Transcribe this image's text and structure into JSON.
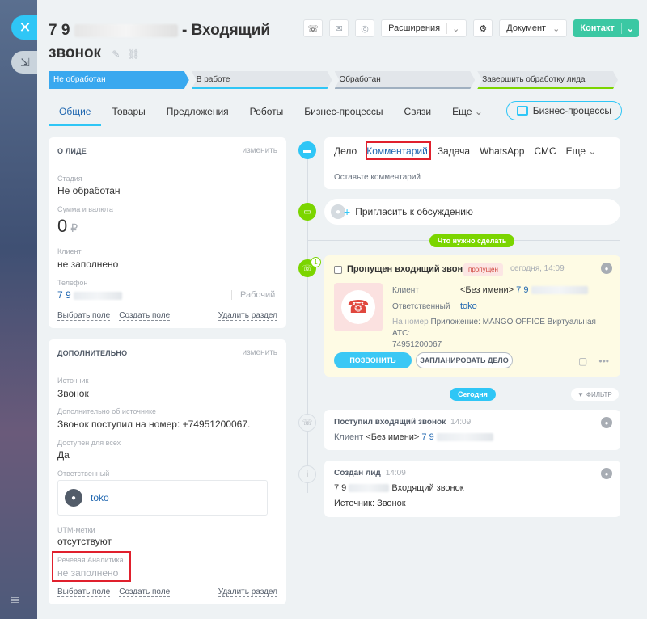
{
  "header": {
    "title_prefix": "7 9",
    "title_suffix": "- Входящий",
    "title_line2": "звонок",
    "extensions_label": "Расширения",
    "document_label": "Документ",
    "contact_label": "Контакт"
  },
  "stages": [
    {
      "label": "Не обработан"
    },
    {
      "label": "В работе"
    },
    {
      "label": "Обработан"
    },
    {
      "label": "Завершить обработку лида"
    }
  ],
  "tabs": [
    {
      "label": "Общие"
    },
    {
      "label": "Товары"
    },
    {
      "label": "Предложения"
    },
    {
      "label": "Роботы"
    },
    {
      "label": "Бизнес-процессы"
    },
    {
      "label": "Связи"
    },
    {
      "label": "Еще"
    }
  ],
  "bp_button": "Бизнес-процессы",
  "about": {
    "heading": "О ЛИДЕ",
    "edit": "изменить",
    "stage_label": "Стадия",
    "stage_value": "Не обработан",
    "sum_label": "Сумма и валюта",
    "sum_value": "0",
    "currency": "₽",
    "client_label": "Клиент",
    "client_value": "не заполнено",
    "phone_label": "Телефон",
    "phone_value": "7 9",
    "phone_type": "Рабочий",
    "select_field": "Выбрать поле",
    "create_field": "Создать поле",
    "delete_section": "Удалить раздел"
  },
  "extra": {
    "heading": "ДОПОЛНИТЕЛЬНО",
    "edit": "изменить",
    "source_label": "Источник",
    "source_value": "Звонок",
    "source_more_label": "Дополнительно об источнике",
    "source_more_value": "Звонок поступил на номер: +74951200067.",
    "avail_label": "Доступен для всех",
    "avail_value": "Да",
    "resp_label": "Ответственный",
    "resp_value": "toko",
    "utm_label": "UTM-метки",
    "utm_value": "отсутствуют",
    "speech_label": "Речевая Аналитика",
    "speech_value": "не заполнено",
    "select_field": "Выбрать поле",
    "create_field": "Создать поле",
    "delete_section": "Удалить раздел"
  },
  "composer": {
    "tabs": [
      "Дело",
      "Комментарий",
      "Задача",
      "WhatsApp",
      "СМС",
      "Еще"
    ],
    "placeholder": "Оставьте комментарий"
  },
  "invite": "Пригласить к обсуждению",
  "todo_pill": "Что нужно сделать",
  "todo": {
    "title": "Пропущен входящий звонок",
    "badge": "пропущен",
    "time": "сегодня, 14:09",
    "client_label": "Клиент",
    "client_value": "<Без имени>",
    "client_phone": "7 9",
    "resp_label": "Ответственный",
    "resp_value": "toko",
    "number_label": "На номер",
    "app_label": "Приложение: MANGO OFFICE Виртуальная АТС:",
    "app_number": "74951200067",
    "call_btn": "ПОЗВОНИТЬ",
    "plan_btn": "ЗАПЛАНИРОВАТЬ ДЕЛО",
    "count": "1"
  },
  "today_pill": "Сегодня",
  "filter": "ФИЛЬТР",
  "hist1": {
    "title": "Поступил входящий звонок",
    "time": "14:09",
    "client_label": "Клиент",
    "client_value": "<Без имени>",
    "client_phone": "7 9"
  },
  "hist2": {
    "title": "Создан лид",
    "time": "14:09",
    "line1_prefix": "7 9",
    "line1_suffix": "Входящий звонок",
    "line2": "Источник: Звонок"
  },
  "colors": {
    "accent": "#2fc6f6",
    "green": "#7bd500",
    "contact": "#3bc8a3",
    "highlight": "#e0202d"
  }
}
